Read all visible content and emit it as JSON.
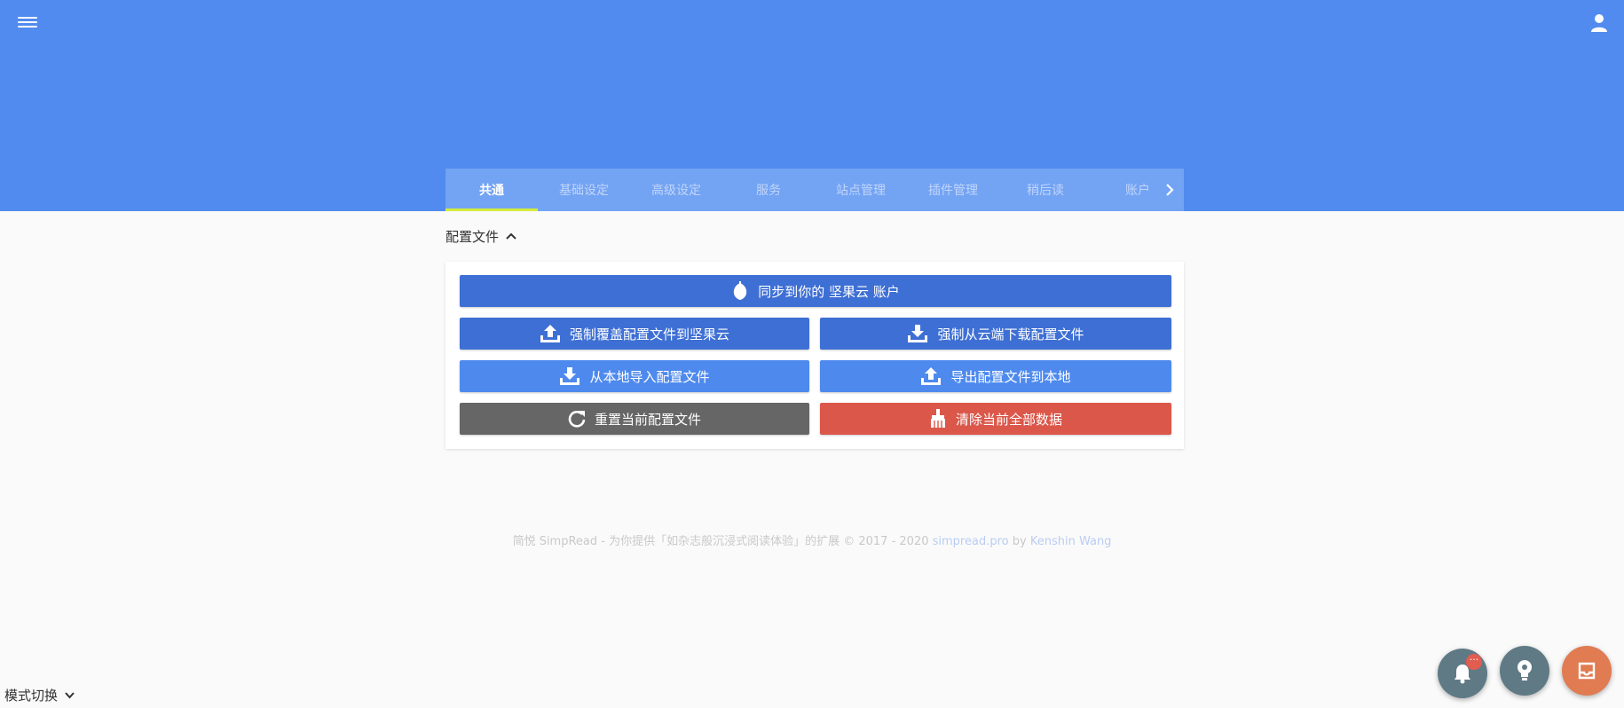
{
  "colors": {
    "header_bg": "#518bef",
    "tabs_bg": "#73a3f3",
    "tab_indicator": "#d6ec3a",
    "btn_dark_blue": "#3e6fd4",
    "btn_light_blue": "#4e8aee",
    "btn_gray": "#666666",
    "btn_red": "#db574a",
    "fab_gray": "#5f7a85",
    "fab_orange": "#e07b52"
  },
  "header": {
    "menu_icon": "hamburger-menu-icon",
    "user_icon": "user-icon"
  },
  "tabs": [
    {
      "label": "共通",
      "active": true
    },
    {
      "label": "基础设定",
      "active": false
    },
    {
      "label": "高级设定",
      "active": false
    },
    {
      "label": "服务",
      "active": false
    },
    {
      "label": "站点管理",
      "active": false
    },
    {
      "label": "插件管理",
      "active": false
    },
    {
      "label": "稍后读",
      "active": false
    },
    {
      "label": "账户",
      "active": false
    }
  ],
  "section": {
    "title": "配置文件"
  },
  "buttons": {
    "sync": {
      "label": "同步到你的 坚果云 账户",
      "icon": "nut-icon"
    },
    "force_upload": {
      "label": "强制覆盖配置文件到坚果云",
      "icon": "upload-tray-icon"
    },
    "force_download": {
      "label": "强制从云端下载配置文件",
      "icon": "download-tray-icon"
    },
    "import_local": {
      "label": "从本地导入配置文件",
      "icon": "download-tray-icon"
    },
    "export_local": {
      "label": "导出配置文件到本地",
      "icon": "upload-tray-icon"
    },
    "reset": {
      "label": "重置当前配置文件",
      "icon": "refresh-icon"
    },
    "clear": {
      "label": "清除当前全部数据",
      "icon": "broom-icon"
    }
  },
  "footer": {
    "text": "简悦 SimpRead - 为你提供「如杂志般沉浸式阅读体验」的扩展 © 2017 - 2020",
    "site_link": "simpread.pro",
    "by": "by",
    "author_link": "Kenshin Wang"
  },
  "mode_switch": {
    "label": "模式切换"
  },
  "fabs": {
    "notify_badge": "···",
    "notify_icon": "bell-icon",
    "idea_icon": "lightbulb-icon",
    "action_icon": "inbox-icon"
  }
}
